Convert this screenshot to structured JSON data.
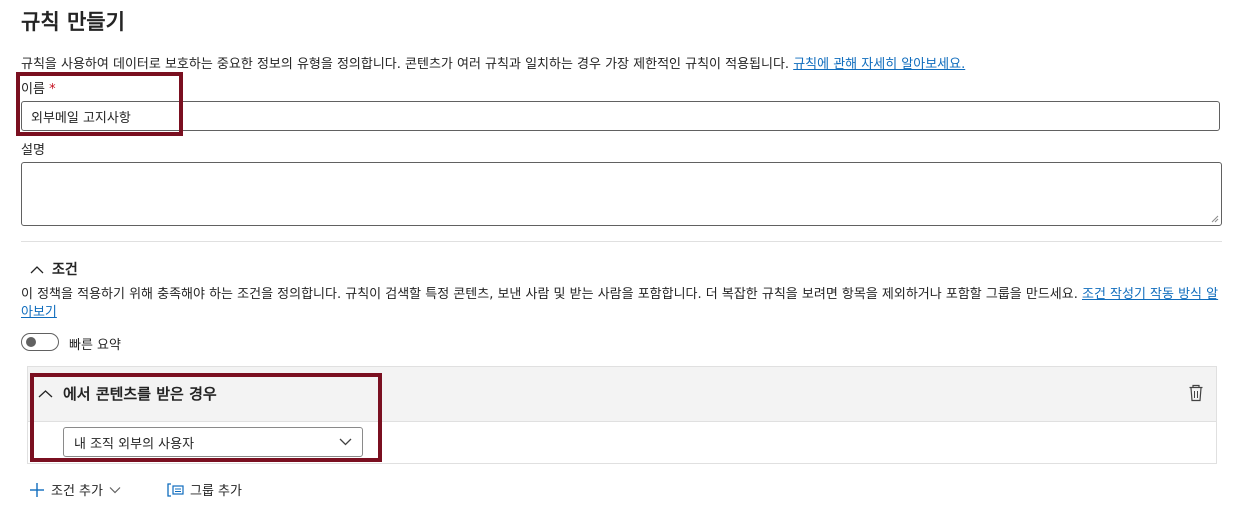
{
  "page": {
    "title": "규칙 만들기",
    "description": "규칙을 사용하여 데이터로 보호하는 중요한 정보의 유형을 정의합니다. 콘텐츠가 여러 규칙과 일치하는 경우 가장 제한적인 규칙이 적용됩니다. ",
    "learn_more_link": "규칙에 관해 자세히 알아보세요."
  },
  "form": {
    "name_label": "이름",
    "required_mark": "*",
    "name_value": "외부메일 고지사항",
    "description_label": "설명",
    "description_value": ""
  },
  "conditions": {
    "section_title": "조건",
    "description": "이 정책을 적용하기 위해 충족해야 하는 조건을 정의합니다. 규칙이 검색할 특정 콘텐츠, 보낸 사람 및 받는 사람을 포함합니다. 더 복잡한 규칙을 보려면 항목을 제외하거나 포함할 그룹을 만드세요. ",
    "learn_link": "조건 작성기 작동 방식 알아보기",
    "quick_summary_label": "빠른 요약",
    "quick_summary_on": false,
    "card": {
      "title": "에서 콘텐츠를 받은 경우",
      "selected_value": "내 조직 외부의 사용자"
    },
    "add_condition_label": "조건 추가",
    "add_group_label": "그룹 추가"
  },
  "colors": {
    "accent": "#0f6cbd",
    "highlight": "#7a0f20",
    "required": "#c50f1f"
  },
  "icons": [
    "chevron-up-icon",
    "delete-icon",
    "chevron-down-icon",
    "add-icon",
    "add-group-icon"
  ]
}
